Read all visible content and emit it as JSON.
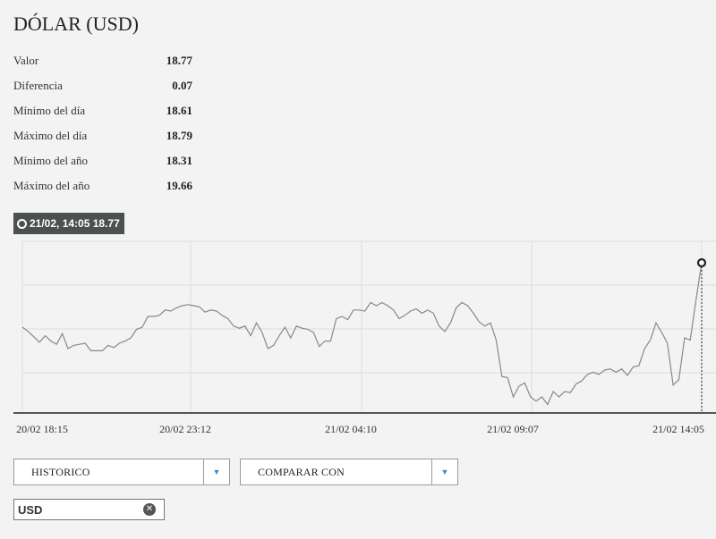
{
  "title": "DÓLAR (USD)",
  "stats": [
    {
      "label": "Valor",
      "value": "18.77"
    },
    {
      "label": "Diferencia",
      "value": "0.07"
    },
    {
      "label": "Mínimo del día",
      "value": "18.61"
    },
    {
      "label": "Máximo del día",
      "value": "18.79"
    },
    {
      "label": "Mínimo del año",
      "value": "18.31"
    },
    {
      "label": "Máximo del año",
      "value": "19.66"
    }
  ],
  "tooltip": {
    "text": "21/02, 14:05 18.77"
  },
  "chart_data": {
    "type": "line",
    "series": [
      {
        "values": [
          18.71,
          18.706,
          18.701,
          18.696,
          18.702,
          18.697,
          18.694,
          18.704,
          18.69,
          18.693,
          18.694,
          18.695,
          18.688,
          18.688,
          18.688,
          18.693,
          18.691,
          18.695,
          18.697,
          18.7,
          18.708,
          18.71,
          18.72,
          18.72,
          18.721,
          18.726,
          18.725,
          18.728,
          18.73,
          18.731,
          18.73,
          18.729,
          18.724,
          18.726,
          18.725,
          18.721,
          18.718,
          18.711,
          18.709,
          18.711,
          18.702,
          18.714,
          18.705,
          18.69,
          18.693,
          18.702,
          18.71,
          18.7,
          18.711,
          18.709,
          18.708,
          18.705,
          18.692,
          18.697,
          18.697,
          18.718,
          18.72,
          18.717,
          18.726,
          18.726,
          18.725,
          18.733,
          18.73,
          18.733,
          18.73,
          18.726,
          18.718,
          18.721,
          18.725,
          18.727,
          18.723,
          18.726,
          18.723,
          18.711,
          18.706,
          18.714,
          18.728,
          18.733,
          18.73,
          18.723,
          18.715,
          18.711,
          18.714,
          18.698,
          18.664,
          18.663,
          18.645,
          18.655,
          18.658,
          18.645,
          18.641,
          18.645,
          18.638,
          18.65,
          18.645,
          18.65,
          18.649,
          18.657,
          18.66,
          18.666,
          18.668,
          18.666,
          18.67,
          18.671,
          18.668,
          18.671,
          18.665,
          18.673,
          18.674,
          18.69,
          18.698,
          18.714,
          18.705,
          18.695,
          18.656,
          18.661,
          18.7,
          18.698,
          18.735,
          18.77
        ]
      }
    ],
    "x_ticks": [
      "20/02 18:15",
      "20/02 23:12",
      "21/02 04:10",
      "21/02 09:07",
      "21/02 14:05"
    ],
    "y_range": [
      18.63,
      18.79
    ],
    "grid": true
  },
  "controls": {
    "historico_label": "HISTORICO",
    "comparar_label": "COMPARAR CON",
    "arrow": "▼"
  },
  "tag": {
    "label": "USD",
    "close": "✕"
  }
}
